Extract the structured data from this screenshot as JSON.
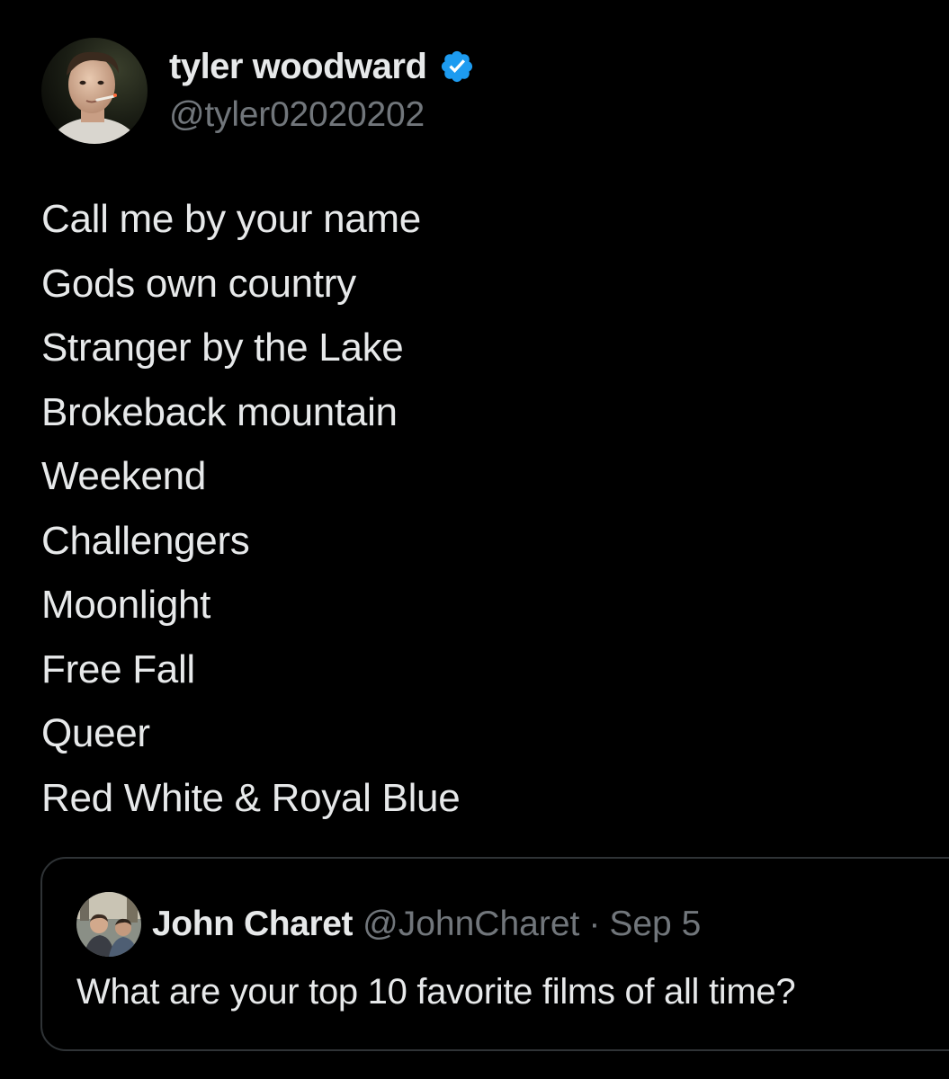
{
  "tweet": {
    "author": {
      "display_name": "tyler woodward",
      "handle": "@tyler02020202",
      "verified": true,
      "avatar_icon": "profile-photo",
      "verified_color": "#1d9bf0"
    },
    "lines": [
      "Call me by your name",
      "Gods own country",
      "Stranger by the Lake",
      "Brokeback mountain",
      "Weekend",
      "Challengers",
      "Moonlight",
      "Free Fall",
      "Queer",
      "Red White & Royal Blue"
    ]
  },
  "quoted_tweet": {
    "display_name": "John Charet",
    "handle": "@JohnCharet",
    "separator": "·",
    "date": "Sep 5",
    "text": "What are your top 10 favorite films of all time?",
    "avatar_icon": "profile-photo"
  },
  "colors": {
    "background": "#000000",
    "primary_text": "#e7e9ea",
    "secondary_text": "#71767b",
    "border": "#2f3336",
    "accent": "#1d9bf0"
  }
}
